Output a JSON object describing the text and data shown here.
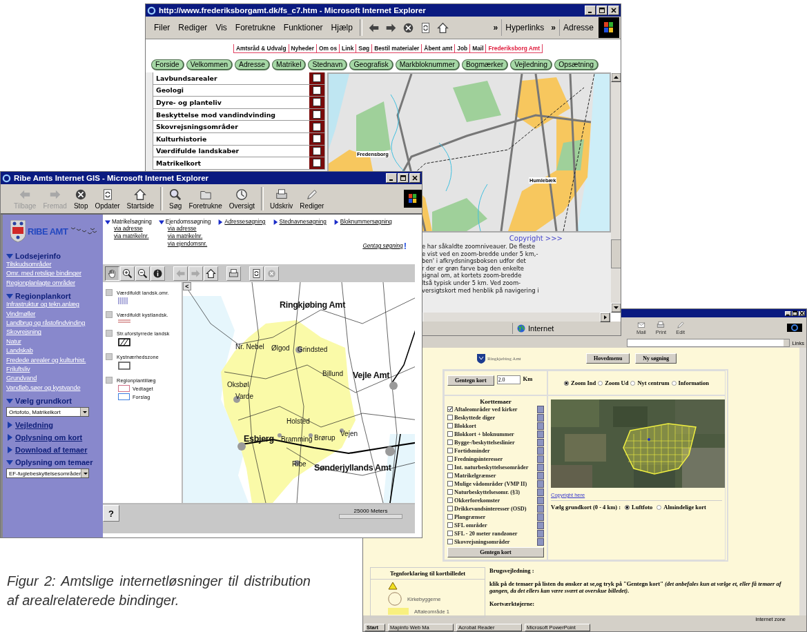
{
  "frederiksborg_window": {
    "title": "http://www.frederiksborgamt.dk/fs_c7.htm - Microsoft Internet Explorer",
    "menu": [
      "Filer",
      "Rediger",
      "Vis",
      "Foretrukne",
      "Funktioner",
      "Hjælp"
    ],
    "nav_icons": [
      {
        "kind": "back"
      },
      {
        "kind": "forward"
      },
      {
        "kind": "stop"
      },
      {
        "kind": "refresh"
      },
      {
        "kind": "home"
      }
    ],
    "toolbar_labels": [
      "»",
      "Hyperlinks",
      "»",
      "Adresse"
    ],
    "top_links": [
      {
        "label": "Amtsråd & Udvalg",
        "selected": false
      },
      {
        "label": "Nyheder",
        "selected": false
      },
      {
        "label": "Om os",
        "selected": false
      },
      {
        "label": "Link",
        "selected": false
      },
      {
        "label": "Søg",
        "selected": false
      },
      {
        "label": "Bestil materialer",
        "selected": false
      },
      {
        "label": "Åbent amt",
        "selected": false
      },
      {
        "label": "Job",
        "selected": false
      },
      {
        "label": "Mail",
        "selected": false
      },
      {
        "label": "Frederiksborg Amt",
        "selected": true
      }
    ],
    "nav_buttons": [
      "Forside",
      "Velkommen",
      "Adresse",
      "Matrikel",
      "Stednavn",
      "Geografisk",
      "Markbloknummer",
      "Bogmærker",
      "Vejledning",
      "Opsætning"
    ],
    "layers": [
      {
        "label": "Lavbundsarealer",
        "checked": false
      },
      {
        "label": "Geologi",
        "checked": false
      },
      {
        "label": "Dyre- og planteliv",
        "checked": false
      },
      {
        "label": "Beskyttelse mod vandindvinding",
        "checked": false
      },
      {
        "label": "Skovrejsningsområder",
        "checked": false
      },
      {
        "label": "Kulturhistorie",
        "checked": false
      },
      {
        "label": "Værdifulde landskaber",
        "checked": false
      },
      {
        "label": "Matrikelkort",
        "checked": false
      }
    ],
    "map_places": [
      "Fredensborg",
      "Humlebæk"
    ],
    "copyright_link": "Copyright >>>",
    "paragraph_lines": [
      "e har såkaldte zoomniveauer. De fleste",
      "e vist ved en zoom-bredde under 5 km,-",
      "ben' i afkrydsningsboksen udfor det",
      "r der er grøn farve bag den enkelte",
      "signal om, at kortets zoom-bredde",
      "ltså typisk under 5 km. Ved zoom-",
      "versigtskort med henblik på navigering i"
    ],
    "status": "Internet"
  },
  "ribe_window": {
    "title": "Ribe Amts Internet GIS - Microsoft Internet Explorer",
    "toolbar": [
      {
        "kind": "back",
        "label": "Tilbage",
        "disabled": true
      },
      {
        "kind": "forward",
        "label": "Fremad",
        "disabled": true
      },
      {
        "kind": "stop",
        "label": "Stop",
        "disabled": false
      },
      {
        "kind": "refresh",
        "label": "Opdater",
        "disabled": false
      },
      {
        "kind": "home",
        "label": "Startside",
        "disabled": false
      },
      {
        "kind": "search",
        "label": "Søg",
        "disabled": false
      },
      {
        "kind": "favorites",
        "label": "Foretrukne",
        "disabled": false
      },
      {
        "kind": "history",
        "label": "Oversigt",
        "disabled": false
      },
      {
        "kind": "print",
        "label": "Udskriv",
        "disabled": false
      },
      {
        "kind": "edit",
        "label": "Rediger",
        "disabled": false
      }
    ],
    "logo": "RIBE AMT",
    "sections": [
      {
        "title": "Lodsejerinfo",
        "expanded": true,
        "links": [
          "Tilskudsområder",
          "Omr. med retslige bindinger",
          "Regionplanlagte områder"
        ]
      },
      {
        "title": "Regionplankort",
        "expanded": true,
        "links": [
          "Infrastruktur og tekn.anlæg",
          "Vindmøller",
          "Landbrug og råstofindvinding",
          "Skovrejsning",
          "Natur",
          "Landskab",
          "Fredede arealer og kulturhist.",
          "Friluftsliv",
          "Grundvand",
          "Vandløb,søer og kystvande"
        ]
      },
      {
        "title": "Vælg grundkort",
        "expanded": true,
        "select": "Ortofoto, Matrikelkort"
      },
      {
        "title": "Vejledning",
        "expanded": false
      },
      {
        "title": "Oplysning om kort",
        "expanded": false
      },
      {
        "title": "Download af temaer",
        "expanded": false
      },
      {
        "title": "Oplysning om temaer",
        "expanded": true,
        "select": "EF-fuglebeskyttelsesområder"
      }
    ],
    "searches": [
      {
        "title": "Matrikelsøgning",
        "expanded": true,
        "links": [
          "via adresse",
          "via matrikelnr."
        ]
      },
      {
        "title": "Ejendomssøgning",
        "expanded": true,
        "links": [
          "via adresse",
          "via matrikelnr.",
          "via ejendomsnr."
        ]
      },
      {
        "title": "Adressesøgning",
        "expanded": false
      },
      {
        "title": "Stednavnesøgning",
        "expanded": false
      },
      {
        "title": "Bloknummersøgning",
        "expanded": false
      }
    ],
    "repeat_search": "Gentag søgning",
    "repeat_mark": "!",
    "map_tools": [
      {
        "kind": "pan",
        "selected": true,
        "disabled": false
      },
      {
        "kind": "zoom-in",
        "selected": false,
        "disabled": false
      },
      {
        "kind": "zoom-out",
        "selected": false,
        "disabled": false
      },
      {
        "kind": "info",
        "selected": false,
        "disabled": false
      },
      {
        "kind": "back",
        "selected": false,
        "disabled": true
      },
      {
        "kind": "forward",
        "selected": false,
        "disabled": true
      },
      {
        "kind": "home",
        "selected": false,
        "disabled": false
      },
      {
        "kind": "print",
        "selected": false,
        "disabled": false
      },
      {
        "kind": "refresh",
        "selected": false,
        "disabled": false
      },
      {
        "kind": "cancel",
        "selected": false,
        "disabled": true
      }
    ],
    "collapse_mark": "<",
    "legend": [
      {
        "kind": "hatch-lines",
        "label": "Værdifuldt landsk.omr.",
        "checked": false
      },
      {
        "kind": "double-line",
        "label": "Værdifuldt kystlandsk.",
        "checked": false
      },
      {
        "kind": "hatch-box",
        "label": "Str.uforstyrrede landsk",
        "checked": false
      },
      {
        "kind": "box",
        "label": "Kystnærhedszone",
        "checked": false
      },
      {
        "kind": "group",
        "label": "Regionplantillæg",
        "checked": false,
        "children": [
          {
            "label": "Vedtaget",
            "color": "#d07088"
          },
          {
            "label": "Forslag",
            "color": "#3c7ee0"
          }
        ]
      }
    ],
    "map_places": [
      "Ringkjøbing Amt",
      "Nr. Nebel",
      "Ølgod",
      "Grindsted",
      "Billund",
      "Vejle Amt",
      "Oksbøl",
      "Varde",
      "Holsted",
      "Esbjerg",
      "Bramming",
      "Brørup",
      "Vejen",
      "Ribe",
      "Sønderjyllands Amt"
    ],
    "help_mark": "?",
    "scale": "25000 Meters"
  },
  "ringkobing_window": {
    "toolbar": [
      {
        "kind": "mail",
        "label": "Mail"
      },
      {
        "kind": "print",
        "label": "Print"
      },
      {
        "kind": "edit",
        "label": "Edit"
      }
    ],
    "links_label": "Links",
    "logo": "Ringkjøbing Amt",
    "header_buttons": [
      "Hovedmenu",
      "Ny søgning"
    ],
    "redraw_button": "Gentegn kort",
    "zoom_value": "2.0",
    "zoom_unit": "Km",
    "modes": [
      {
        "label": "Zoom Ind",
        "selected": true
      },
      {
        "label": "Zoom Ud",
        "selected": false
      },
      {
        "label": "Nyt centrum",
        "selected": false
      },
      {
        "label": "Information",
        "selected": false
      }
    ],
    "themes_title": "Korttemaer",
    "themes": [
      {
        "label": "Aftaleområder ved kirker",
        "checked": true
      },
      {
        "label": "Beskyttede diger",
        "checked": false
      },
      {
        "label": "Blokkort",
        "checked": false
      },
      {
        "label": "Blokkort + bloknummer",
        "checked": false
      },
      {
        "label": "Bygge-/beskyttelseslinier",
        "checked": false
      },
      {
        "label": "Fortidsminder",
        "checked": false
      },
      {
        "label": "Fredningsinteresser",
        "checked": false
      },
      {
        "label": "Int. naturbeskyttelsesområder",
        "checked": false
      },
      {
        "label": "Matrikelgrænser",
        "checked": false
      },
      {
        "label": "Mulige vådområder (VMP II)",
        "checked": false
      },
      {
        "label": "Naturbeskyttelsesomr. (§3)",
        "checked": false
      },
      {
        "label": "Okkerforekomster",
        "checked": false
      },
      {
        "label": "Drikkevandsinteresser (OSD)",
        "checked": false
      },
      {
        "label": "Plangrænser",
        "checked": false
      },
      {
        "label": "SFL områder",
        "checked": false
      },
      {
        "label": "SFL - 20 meter randzoner",
        "checked": false
      },
      {
        "label": "Skovrejsningsområder",
        "checked": false
      }
    ],
    "redraw_button_bottom": "Gentegn kort",
    "copyright_link": "Copyright here",
    "basemap_label": "Vælg grundkort (0 - 4 km) :",
    "basemaps": [
      {
        "label": "Luftfoto",
        "selected": true
      },
      {
        "label": "Almindelige kort",
        "selected": false
      }
    ],
    "legend_title": "Tegnforklaring til kortbilledet",
    "legend": [
      {
        "kind": "triangle"
      },
      {
        "kind": "circle",
        "label": "Kirkebyggerne"
      },
      {
        "kind": "area",
        "label": "Aftaleområde 1"
      }
    ],
    "help_title": "Brugsvejledning :",
    "help_text": "klik på de temaer på listen du ønsker at se,og tryk på \"Gentegn kort\" *(det anbefales kun at vælge et, eller få temaer af gangen, da det ellers kan være svært at overskue billedet).*",
    "tools_title": "Kortværktøjerne:",
    "status": "Internet zone",
    "taskbar": [
      "Start",
      "Mapinfo Web Ma",
      "Acrobat Reader",
      "Microsoft PowerPoint"
    ]
  },
  "caption": "Figur 2: Amtslige internetløsninger til distribution af arealrelaterede bindinger."
}
